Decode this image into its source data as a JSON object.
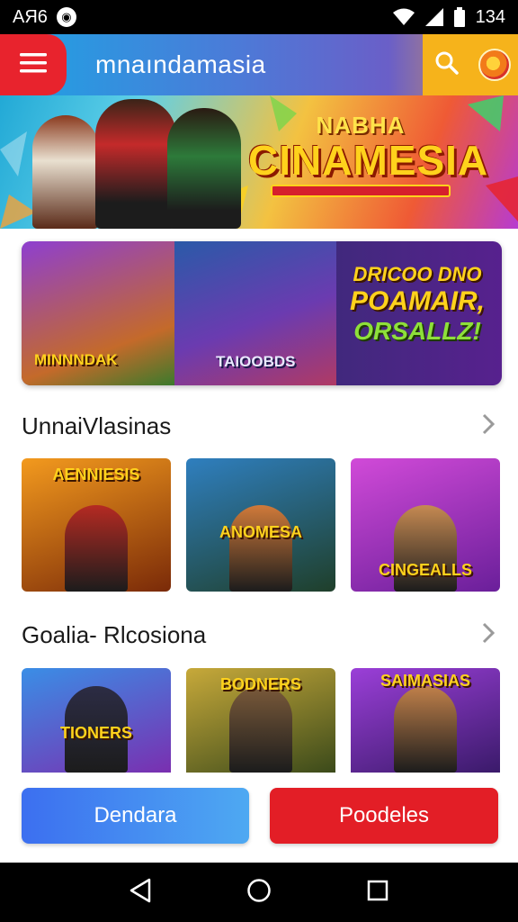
{
  "status_bar": {
    "left_text": "AЯ6",
    "time": "134"
  },
  "header": {
    "title": "mnaındamasia"
  },
  "hero": {
    "logo_small": "NABHA",
    "logo_big": "CINAMESIA"
  },
  "promo": {
    "left_label": "MINNNDAK",
    "mid_label": "TAIOOBDS",
    "line1": "DRICOO DNO",
    "line2": "POAMAIR,",
    "line3": "ORSALLZ!"
  },
  "sections": [
    {
      "title": "UnnaiVlasinas",
      "cards": [
        {
          "label": "AENNIESIS",
          "bg_from": "#f39a1e",
          "bg_to": "#7a2a08",
          "figure": "#b52a22"
        },
        {
          "label": "ANOMESA",
          "bg_from": "#2f7fbf",
          "bg_to": "#1f3f2a",
          "figure": "#d07a3a"
        },
        {
          "label": "CINGEALLS",
          "bg_from": "#d14ad8",
          "bg_to": "#6a1f9a",
          "figure": "#c68a52"
        }
      ]
    },
    {
      "title": "Goalia- Rlcosiona",
      "cards": [
        {
          "label": "TIONERS",
          "bg_from": "#3a8ee6",
          "bg_to": "#7a2fb0",
          "figure": "#2c2c44"
        },
        {
          "label": "BODNERS",
          "bg_from": "#c7a93a",
          "bg_to": "#3b4a1a",
          "figure": "#7a5a3a"
        },
        {
          "label": "SAIMASIAS",
          "bg_from": "#9b3fd8",
          "bg_to": "#3a1a6a",
          "figure": "#c0804a"
        }
      ]
    }
  ],
  "actions": {
    "primary_label": "Dendara",
    "secondary_label": "Poodeles"
  },
  "colors": {
    "accent_red": "#e31e26",
    "accent_blue": "#3c6ff0",
    "accent_yellow": "#f6b31b"
  },
  "icons": {
    "menu": "hamburger-menu-icon",
    "search": "search-icon",
    "chevron": "chevron-right-icon",
    "back": "back-triangle-icon",
    "home": "home-circle-icon",
    "recents": "recents-square-icon"
  }
}
